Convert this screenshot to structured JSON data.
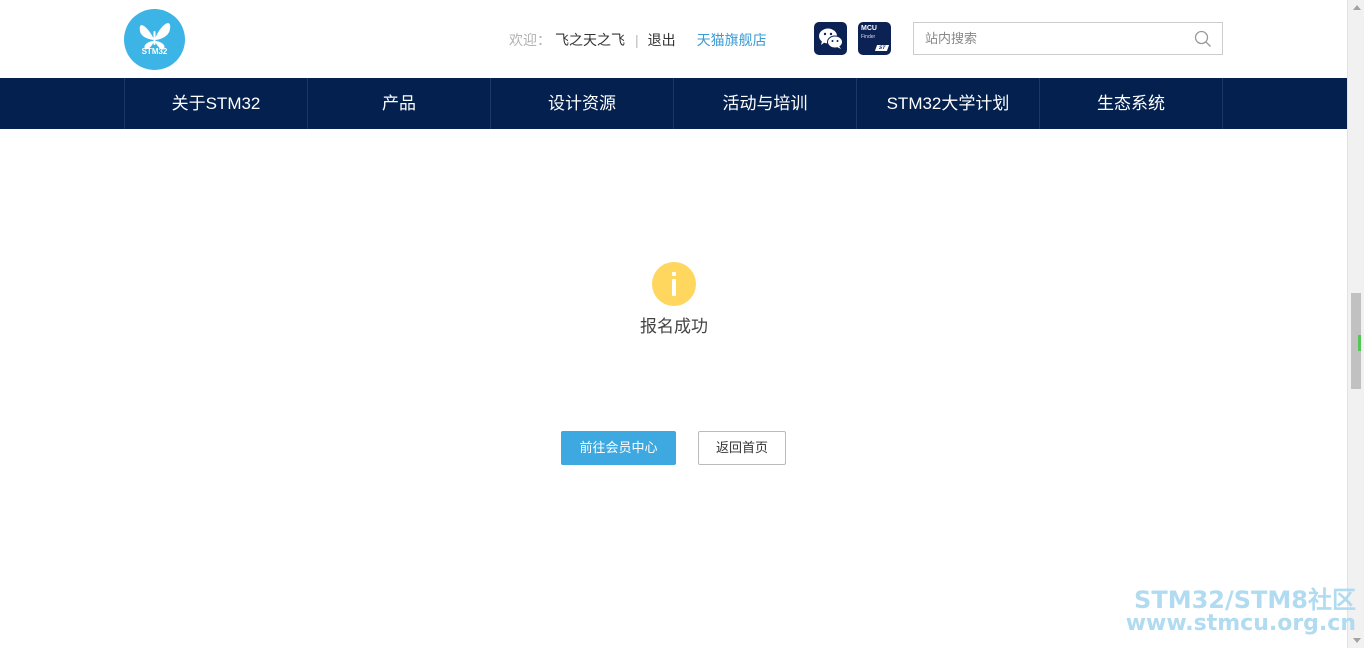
{
  "header": {
    "logo_text": "STM32",
    "welcome_label": "欢迎：",
    "username": "飞之天之飞",
    "separator": "|",
    "logout_label": "退出",
    "tmall_label": "天猫旗舰店",
    "mcu_icon_text": "MCU",
    "mcu_icon_sub": "Finder",
    "mcu_icon_badge": "ST",
    "search": {
      "placeholder": "站内搜索",
      "value": ""
    }
  },
  "nav": {
    "items": [
      {
        "label": "关于STM32"
      },
      {
        "label": "产品"
      },
      {
        "label": "设计资源"
      },
      {
        "label": "活动与培训"
      },
      {
        "label": "STM32大学计划"
      },
      {
        "label": "生态系统"
      }
    ]
  },
  "main": {
    "status_text": "报名成功",
    "buttons": {
      "member_center": "前往会员中心",
      "home": "返回首页"
    }
  },
  "watermark": {
    "line1": "STM32/STM8社区",
    "line2": "www.stmcu.org.cn"
  },
  "colors": {
    "nav_bg": "#03204f",
    "brand_blue": "#3cb4e5",
    "primary_button": "#3ea8e0",
    "info_icon": "#ffd75e",
    "tmall_link": "#3c9bd6"
  },
  "icons": {
    "logo": "butterfly-logo-icon",
    "wechat": "wechat-icon",
    "mcu_finder": "mcu-finder-icon",
    "search": "search-icon",
    "status": "info-icon"
  }
}
